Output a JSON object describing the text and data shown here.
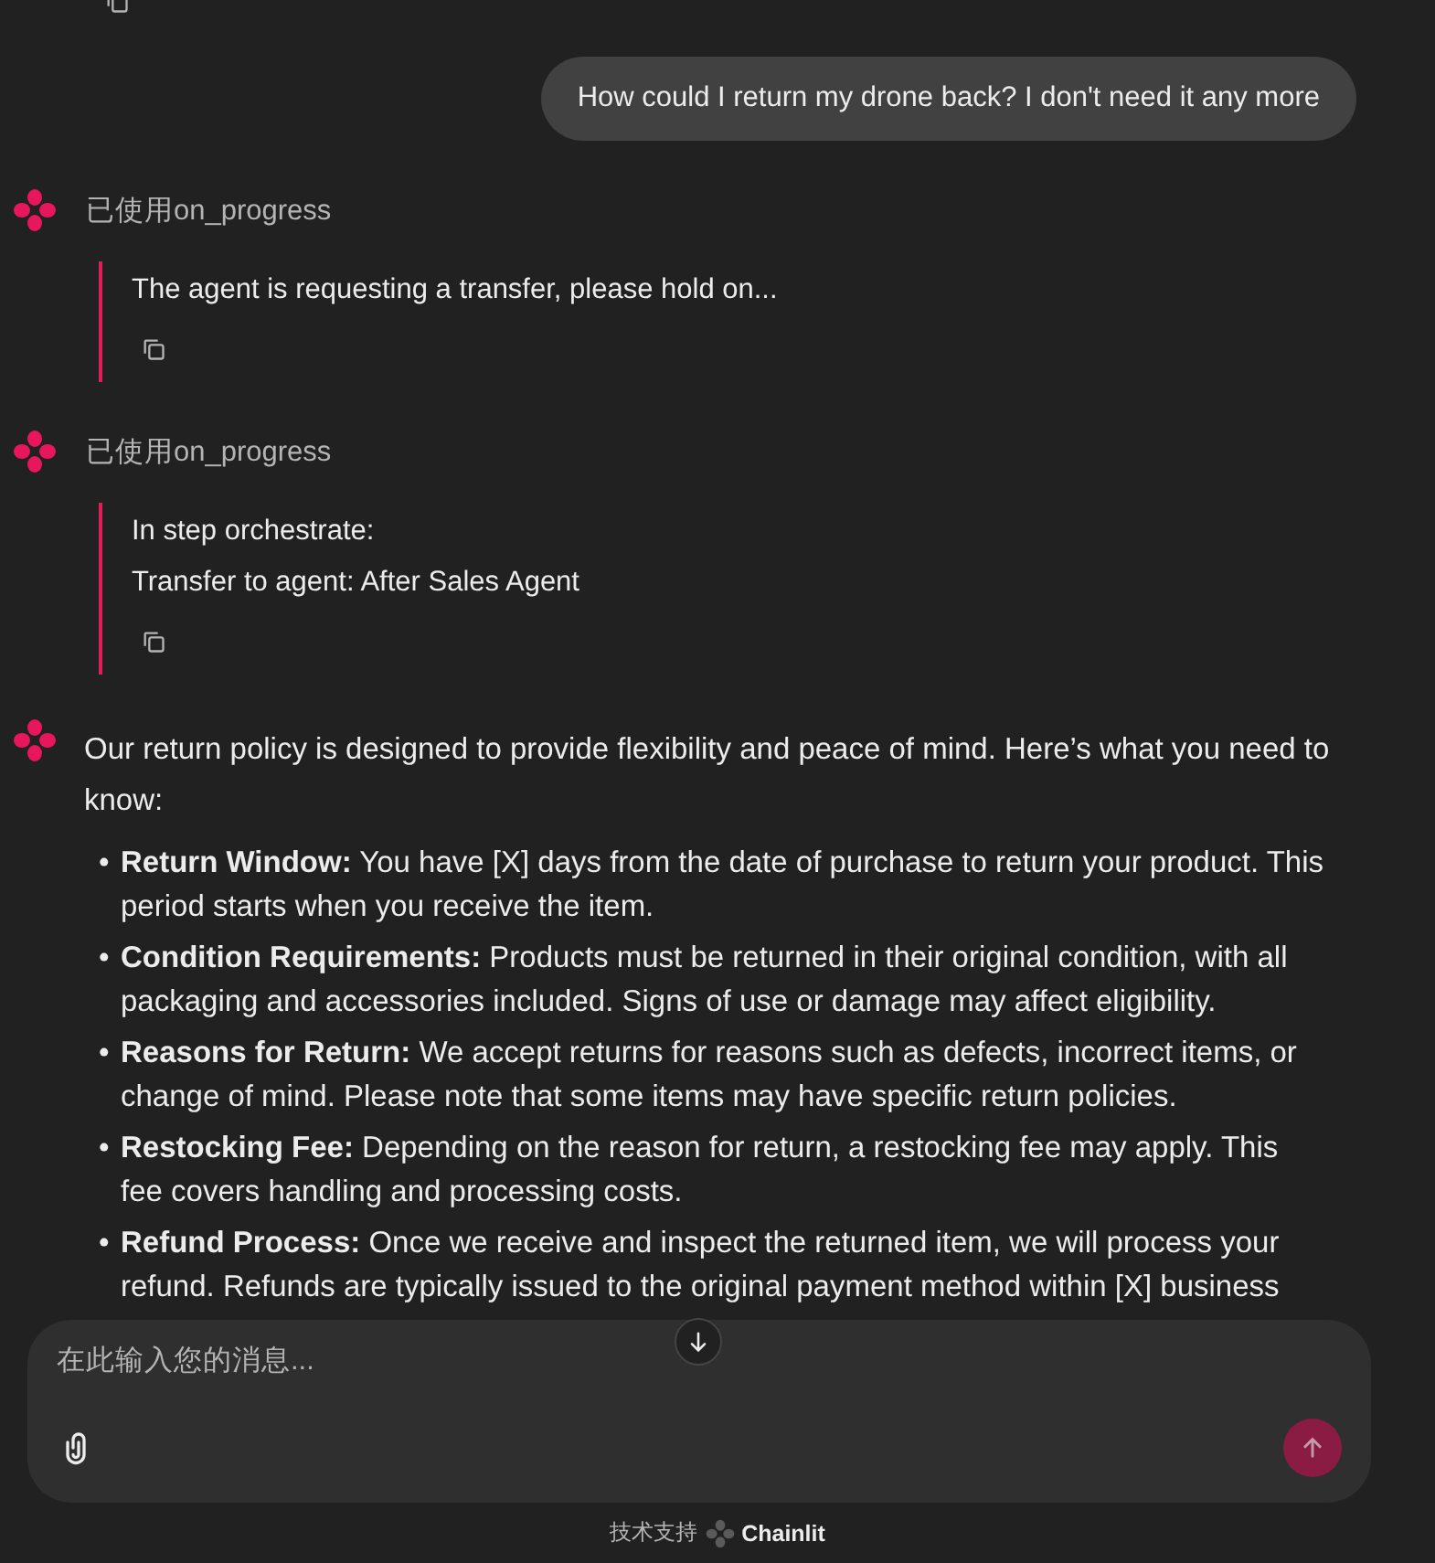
{
  "messages": [
    {
      "kind": "user",
      "text": "How could I return my drone back? I don't need it any more"
    },
    {
      "kind": "step",
      "title": "已使用on_progress",
      "lines": [
        "The agent is requesting a transfer, please hold on..."
      ]
    },
    {
      "kind": "step",
      "title": "已使用on_progress",
      "lines": [
        "In step orchestrate:",
        "Transfer to agent: After Sales Agent"
      ]
    },
    {
      "kind": "assistant",
      "bullet": "•",
      "intro": "Our return policy is designed to provide flexibility and peace of mind. Here’s what you need to know:",
      "items": [
        "**Return Window:** You have [X] days from the date of purchase to return your product. This period starts when you receive the item.",
        "**Condition Requirements:** Products must be returned in their original condition, with all packaging and accessories included. Signs of use or damage may affect eligibility.",
        "**Reasons for Return:** We accept returns for reasons such as defects, incorrect items, or change of mind. Please note that some items may have specific return policies.",
        "**Restocking Fee:** Depending on the reason for return, a restocking fee may apply. This fee covers handling and processing costs.",
        "**Refund Process:** Once we receive and inspect the returned item, we will process your refund. Refunds are typically issued to the original payment method within [X] business"
      ]
    }
  ],
  "composer": {
    "placeholder": "在此输入您的消息..."
  },
  "footer": {
    "label": "技术支持",
    "brand": "Chainlit"
  }
}
